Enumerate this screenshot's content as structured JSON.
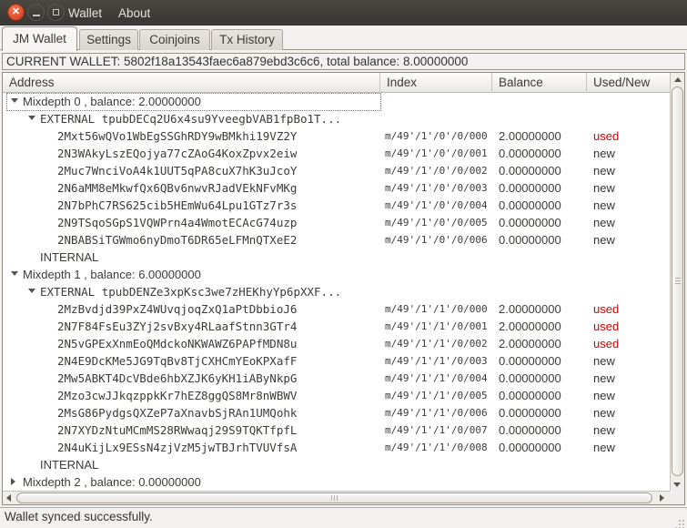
{
  "titlebar": {
    "menu_items": [
      "Wallet",
      "About"
    ]
  },
  "tabs": [
    {
      "label": "JM Wallet",
      "active": true
    },
    {
      "label": "Settings",
      "active": false
    },
    {
      "label": "Coinjoins",
      "active": false
    },
    {
      "label": "Tx History",
      "active": false
    }
  ],
  "current_wallet_line": "CURRENT WALLET: 5802f18a13543faec6a879ebd3c6c6, total balance: 8.00000000",
  "status_bar": "Wallet synced successfully.",
  "colors": {
    "used": "#d40000",
    "new": "#343431",
    "tree_text": "#3c3b37",
    "accent_close": "#dd4a2b"
  },
  "tree": {
    "columns": [
      "Address",
      "Index",
      "Balance",
      "Used/New"
    ],
    "rows": [
      {
        "level": 0,
        "expander": "open",
        "mono": false,
        "focused": true,
        "address": "Mixdepth 0 , balance: 2.00000000",
        "index": "",
        "balance": "",
        "status": ""
      },
      {
        "level": 1,
        "expander": "open",
        "mono": true,
        "address": "EXTERNAL tpubDECq2U6x4su9YveegbVAB1fpBo1T...",
        "index": "",
        "balance": "",
        "status": ""
      },
      {
        "level": 2,
        "mono": true,
        "address": "2Mxt56wQVo1WbEgSSGhRDY9wBMkhi19VZ2Y",
        "index": "m/49'/1'/0'/0/000",
        "balance": "2.00000000",
        "status": "used"
      },
      {
        "level": 2,
        "mono": true,
        "address": "2N3WAkyLszEQojya77cZAoG4KoxZpvx2eiw",
        "index": "m/49'/1'/0'/0/001",
        "balance": "0.00000000",
        "status": "new"
      },
      {
        "level": 2,
        "mono": true,
        "address": "2Muc7WnciVoA4k1UUT5qPA8cuX7hK3uJcoY",
        "index": "m/49'/1'/0'/0/002",
        "balance": "0.00000000",
        "status": "new"
      },
      {
        "level": 2,
        "mono": true,
        "address": "2N6aMM8eMkwfQx6QBv6nwvRJadVEkNFvMKg",
        "index": "m/49'/1'/0'/0/003",
        "balance": "0.00000000",
        "status": "new"
      },
      {
        "level": 2,
        "mono": true,
        "address": "2N7bPhC7RS625cib5HEmWu64Lpu1GTz7r3s",
        "index": "m/49'/1'/0'/0/004",
        "balance": "0.00000000",
        "status": "new"
      },
      {
        "level": 2,
        "mono": true,
        "address": "2N9TSqoSGpS1VQWPrn4a4WmotECAcG74uzp",
        "index": "m/49'/1'/0'/0/005",
        "balance": "0.00000000",
        "status": "new"
      },
      {
        "level": 2,
        "mono": true,
        "address": "2NBABSiTGWmo6nyDmoT6DR65eLFMnQTXeE2",
        "index": "m/49'/1'/0'/0/006",
        "balance": "0.00000000",
        "status": "new"
      },
      {
        "level": 1,
        "mono": false,
        "address": "INTERNAL",
        "index": "",
        "balance": "",
        "status": ""
      },
      {
        "level": 0,
        "expander": "open",
        "mono": false,
        "address": "Mixdepth 1 , balance: 6.00000000",
        "index": "",
        "balance": "",
        "status": ""
      },
      {
        "level": 1,
        "expander": "open",
        "mono": true,
        "address": "EXTERNAL tpubDENZe3xpKsc3we7zHEKhyYp6pXXF...",
        "index": "",
        "balance": "",
        "status": ""
      },
      {
        "level": 2,
        "mono": true,
        "address": "2MzBvdjd39PxZ4WUvqjoqZxQ1aPtDbbioJ6",
        "index": "m/49'/1'/1'/0/000",
        "balance": "2.00000000",
        "status": "used"
      },
      {
        "level": 2,
        "mono": true,
        "address": "2N7F84FsEu3ZYj2svBxy4RLaafStnn3GTr4",
        "index": "m/49'/1'/1'/0/001",
        "balance": "2.00000000",
        "status": "used"
      },
      {
        "level": 2,
        "mono": true,
        "address": "2N5vGPExXnmEoQMdckoNKWAWZ6PAPfMDN8u",
        "index": "m/49'/1'/1'/0/002",
        "balance": "2.00000000",
        "status": "used"
      },
      {
        "level": 2,
        "mono": true,
        "address": "2N4E9DcKMe5JG9TqBv8TjCXHCmYEoKPXafF",
        "index": "m/49'/1'/1'/0/003",
        "balance": "0.00000000",
        "status": "new"
      },
      {
        "level": 2,
        "mono": true,
        "address": "2Mw5ABKT4DcVBde6hbXZJK6yKH1iAByNkpG",
        "index": "m/49'/1'/1'/0/004",
        "balance": "0.00000000",
        "status": "new"
      },
      {
        "level": 2,
        "mono": true,
        "address": "2Mzo3cwJJkqzppkKr7hEZ8ggQS8Mr8nWBWV",
        "index": "m/49'/1'/1'/0/005",
        "balance": "0.00000000",
        "status": "new"
      },
      {
        "level": 2,
        "mono": true,
        "address": "2MsG86PydgsQXZeP7aXnavbSjRAn1UMQohk",
        "index": "m/49'/1'/1'/0/006",
        "balance": "0.00000000",
        "status": "new"
      },
      {
        "level": 2,
        "mono": true,
        "address": "2N7XYDzNtuMCmMS28RWwaqj29S9TQKTfpfL",
        "index": "m/49'/1'/1'/0/007",
        "balance": "0.00000000",
        "status": "new"
      },
      {
        "level": 2,
        "mono": true,
        "address": "2N4uKijLx9ESsN4zjVzM5jwTBJrhTVUVfsA",
        "index": "m/49'/1'/1'/0/008",
        "balance": "0.00000000",
        "status": "new"
      },
      {
        "level": 1,
        "mono": false,
        "address": "INTERNAL",
        "index": "",
        "balance": "",
        "status": ""
      },
      {
        "level": 0,
        "expander": "closed",
        "mono": false,
        "address": "Mixdepth 2 , balance: 0.00000000",
        "index": "",
        "balance": "",
        "status": ""
      }
    ]
  }
}
